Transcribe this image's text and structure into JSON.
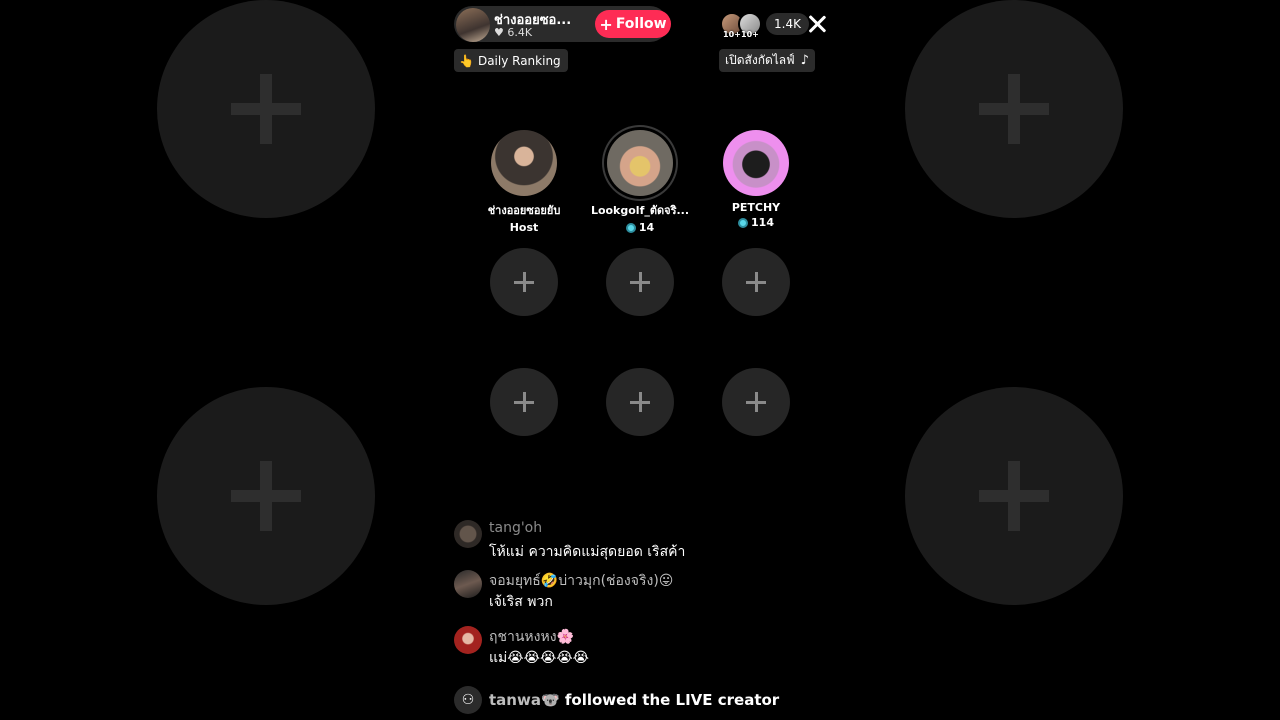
{
  "header": {
    "host_name": "ช่างออยซอ...",
    "likes": "♥ 6.4K",
    "follow_label": "Follow",
    "viewer_count": "1.4K",
    "viewer_badges": [
      "10+",
      "10+"
    ],
    "ranking_label": "Daily Ranking",
    "explore_label": "เปิดสังกัดไลฟ์"
  },
  "seats": [
    {
      "name": "ช่างออยซอยยับ",
      "sub": "Host"
    },
    {
      "name": "Lookgolf_ตัดจริ...",
      "sub": "14"
    },
    {
      "name": "PETCHY",
      "sub": "114"
    }
  ],
  "comments": [
    {
      "user": "tang'oh",
      "text": "โห้แม่ ความคิดแม่สุดยอด เริสค้า"
    },
    {
      "user": "จอมยุทธ์🤣บ่าวมุก(ช่องจริง)😛",
      "text": "เจ้เริส พวก"
    },
    {
      "user": "ฤชานหงหง🌸",
      "text": "แม่😭😭😭😭😭"
    }
  ],
  "follow_event": {
    "user": "tanwa🐨",
    "text": "followed the LIVE creator"
  },
  "colors": {
    "accent": "#fe2c55",
    "coin": "#5ad7e8"
  }
}
